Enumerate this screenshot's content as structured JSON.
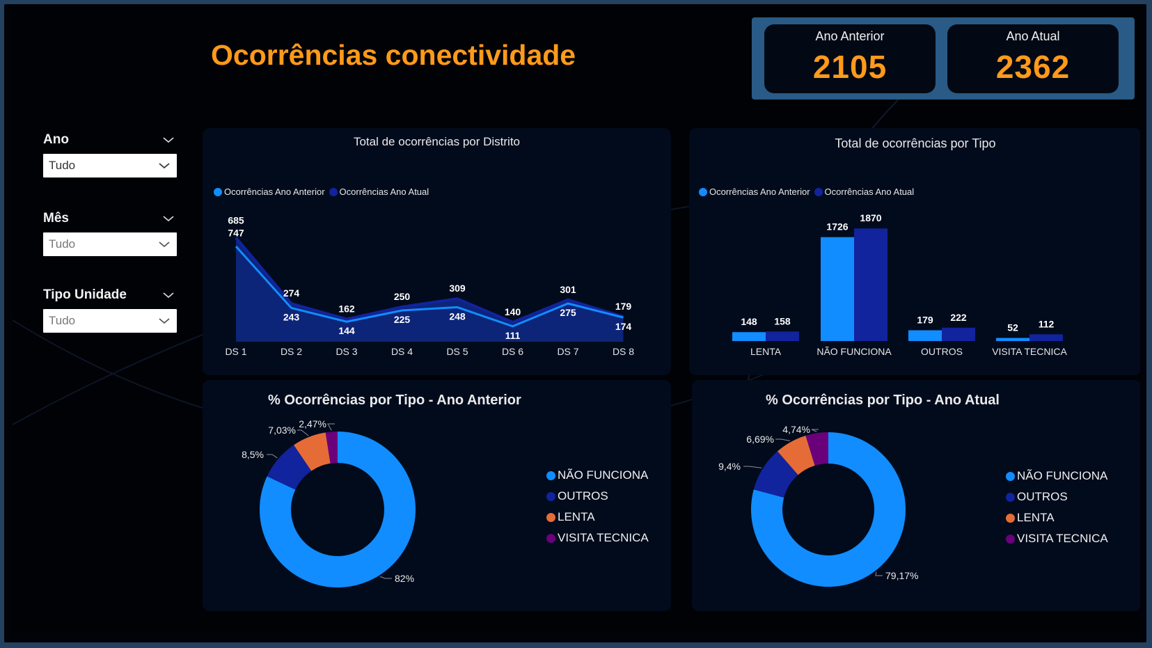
{
  "title": "Ocorrências conectividade",
  "kpis": {
    "previous": {
      "label": "Ano Anterior",
      "value": "2105"
    },
    "current": {
      "label": "Ano Atual",
      "value": "2362"
    }
  },
  "filters": [
    {
      "label": "Ano",
      "value": "Tudo"
    },
    {
      "label": "Mês",
      "value": "Tudo"
    },
    {
      "label": "Tipo Unidade",
      "value": "Tudo"
    }
  ],
  "colors": {
    "accent": "#ff9a1a",
    "previous_series": "#118dff",
    "current_series": "#12239e",
    "lenta": "#e66c37",
    "visita": "#6b007b"
  },
  "chart_data": [
    {
      "type": "area",
      "title": "Total de ocorrências por Distrito",
      "categories": [
        "DS 1",
        "DS 2",
        "DS 3",
        "DS 4",
        "DS 5",
        "DS 6",
        "DS 7",
        "DS 8"
      ],
      "series": [
        {
          "name": "Ocorrências Ano Anterior",
          "values": [
            685,
            243,
            144,
            225,
            248,
            111,
            275,
            174
          ]
        },
        {
          "name": "Ocorrências Ano Atual",
          "values": [
            747,
            274,
            162,
            250,
            309,
            140,
            301,
            179
          ]
        }
      ],
      "legend": "top-left"
    },
    {
      "type": "bar",
      "title": "Total de ocorrências por Tipo",
      "categories": [
        "LENTA",
        "NÃO FUNCIONA",
        "OUTROS",
        "VISITA TECNICA"
      ],
      "series": [
        {
          "name": "Ocorrências Ano Anterior",
          "values": [
            148,
            1726,
            179,
            52
          ]
        },
        {
          "name": "Ocorrências Ano Atual",
          "values": [
            158,
            1870,
            222,
            112
          ]
        }
      ],
      "legend": "top-left"
    },
    {
      "type": "pie",
      "title": "% Ocorrências por Tipo - Ano Anterior",
      "labels": [
        "NÃO FUNCIONA",
        "OUTROS",
        "LENTA",
        "VISITA TECNICA"
      ],
      "values": [
        82,
        8.5,
        7.03,
        2.47
      ],
      "value_labels": [
        "82%",
        "8,5%",
        "7,03%",
        "2,47%"
      ],
      "legend": "right"
    },
    {
      "type": "pie",
      "title": "% Ocorrências por Tipo - Ano Atual",
      "labels": [
        "NÃO FUNCIONA",
        "OUTROS",
        "LENTA",
        "VISITA TECNICA"
      ],
      "values": [
        79.17,
        9.4,
        6.69,
        4.74
      ],
      "value_labels": [
        "79,17%",
        "9,4%",
        "6,69%",
        "4,74%"
      ],
      "legend": "right"
    }
  ]
}
